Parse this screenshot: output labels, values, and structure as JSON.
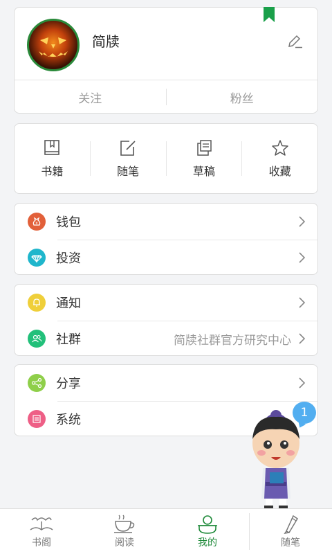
{
  "profile": {
    "username": "简牍",
    "follow_label": "关注",
    "fans_label": "粉丝",
    "avatar_icon": "pumpkin-avatar-icon",
    "edit_icon": "pencil-icon"
  },
  "quick_links": [
    {
      "label": "书籍",
      "icon": "book-icon"
    },
    {
      "label": "随笔",
      "icon": "edit-note-icon"
    },
    {
      "label": "草稿",
      "icon": "drafts-icon"
    },
    {
      "label": "收藏",
      "icon": "star-icon"
    }
  ],
  "menu": {
    "wallet": {
      "label": "钱包",
      "icon": "money-bag-icon",
      "color": "#e2603a"
    },
    "invest": {
      "label": "投资",
      "icon": "diamond-icon",
      "color": "#1fb6cc"
    },
    "notify": {
      "label": "通知",
      "icon": "bell-icon",
      "color": "#efcf3a"
    },
    "community": {
      "label": "社群",
      "value": "简牍社群官方研究中心",
      "icon": "people-icon",
      "color": "#22c07a"
    },
    "share": {
      "label": "分享",
      "icon": "share-icon",
      "color": "#8fcf4a"
    },
    "system": {
      "label": "系统",
      "icon": "settings-list-icon",
      "color": "#ee5f86"
    }
  },
  "tabs": [
    {
      "label": "书阁",
      "icon": "bookhall-icon",
      "active": false
    },
    {
      "label": "阅读",
      "icon": "teacup-icon",
      "active": false
    },
    {
      "label": "我的",
      "icon": "me-icon",
      "active": true
    },
    {
      "label": "随笔",
      "icon": "brush-icon",
      "active": false
    }
  ],
  "mascot": {
    "badge": "1",
    "icon": "scholar-mascot-icon"
  },
  "colors": {
    "accent": "#1f8a3a",
    "background": "#f3f4f6"
  }
}
